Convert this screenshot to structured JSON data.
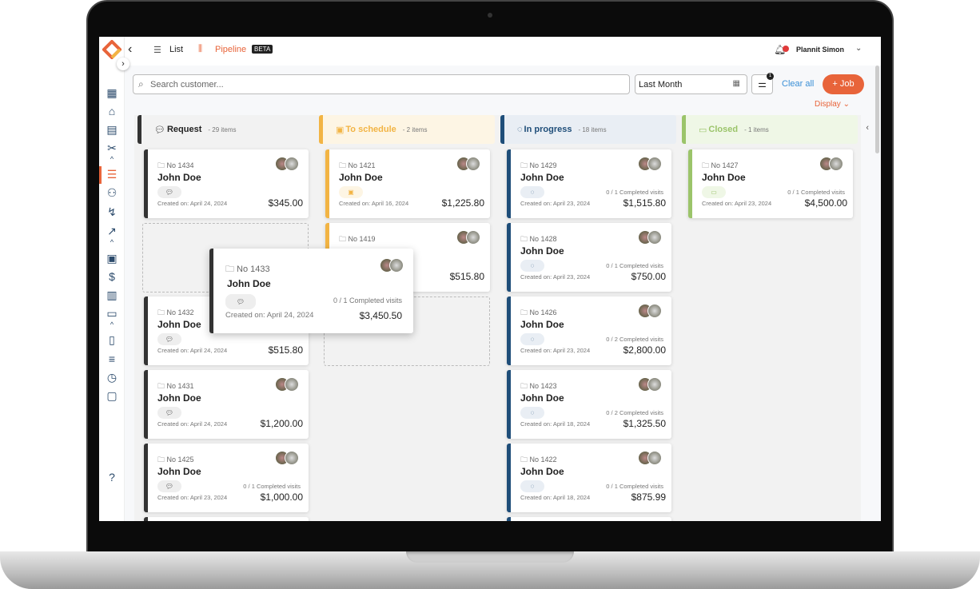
{
  "header": {
    "list_label": "List",
    "pipeline_label": "Pipeline",
    "beta_badge": "BETA",
    "user_name": "Plannit Simon"
  },
  "toolbar": {
    "search_placeholder": "Search customer...",
    "date_filter": "Last Month",
    "filter_count": "1",
    "clear_all": "Clear all",
    "add_job": "Job",
    "display": "Display"
  },
  "colors": {
    "accent": "#e8643a",
    "request": "#333333",
    "schedule": "#f2b444",
    "progress": "#1f4e79",
    "closed": "#9bc46a"
  },
  "columns": [
    {
      "key": "request",
      "title": "Request",
      "count": "- 29 items",
      "icon": "chat-icon",
      "color": "#333333",
      "headbg": "#f2f2f2",
      "textcolor": "#222222",
      "pillbg": "#eeeeee",
      "cards": [
        {
          "no": "No 1434",
          "name": "John Doe",
          "visits": "",
          "created": "Created on: April 24, 2024",
          "amount": "$345.00"
        },
        {
          "placeholder": true
        },
        {
          "no": "No 1432",
          "name": "John Doe",
          "visits": "",
          "created": "Created on: April 24, 2024",
          "amount": "$515.80"
        },
        {
          "no": "No 1431",
          "name": "John Doe",
          "visits": "",
          "created": "Created on: April 24, 2024",
          "amount": "$1,200.00"
        },
        {
          "no": "No 1425",
          "name": "John Doe",
          "visits": "0 / 1 Completed visits",
          "created": "Created on: April 23, 2024",
          "amount": "$1,000.00"
        },
        {
          "partial": true
        }
      ]
    },
    {
      "key": "schedule",
      "title": "To schedule",
      "count": "- 2 items",
      "icon": "calendar-plus-icon",
      "color": "#f2b444",
      "headbg": "#fdf5e4",
      "textcolor": "#f2b444",
      "pillbg": "#fdf5e4",
      "cards": [
        {
          "no": "No 1421",
          "name": "John Doe",
          "visits": "",
          "created": "Created on: April 16, 2024",
          "amount": "$1,225.80"
        },
        {
          "no": "No 1419",
          "name": "",
          "visits": "",
          "created": "",
          "amount": "$515.80"
        },
        {
          "placeholder": true
        }
      ]
    },
    {
      "key": "progress",
      "title": "In progress",
      "count": "- 18 items",
      "icon": "spinner-icon",
      "color": "#1f4e79",
      "headbg": "#e9eef4",
      "textcolor": "#1f4e79",
      "pillbg": "#e9eef4",
      "cards": [
        {
          "no": "No 1429",
          "name": "John Doe",
          "visits": "0 / 1 Completed visits",
          "created": "Created on: April 23, 2024",
          "amount": "$1,515.80"
        },
        {
          "no": "No 1428",
          "name": "John Doe",
          "visits": "0 / 1 Completed visits",
          "created": "Created on: April 23, 2024",
          "amount": "$750.00"
        },
        {
          "no": "No 1426",
          "name": "John Doe",
          "visits": "0 / 2 Completed visits",
          "created": "Created on: April 23, 2024",
          "amount": "$2,800.00"
        },
        {
          "no": "No 1423",
          "name": "John Doe",
          "visits": "0 / 2 Completed visits",
          "created": "Created on: April 18, 2024",
          "amount": "$1,325.50"
        },
        {
          "no": "No 1422",
          "name": "John Doe",
          "visits": "0 / 1 Completed visits",
          "created": "Created on: April 18, 2024",
          "amount": "$875.99"
        },
        {
          "partial": true
        }
      ]
    },
    {
      "key": "closed",
      "title": "Closed",
      "count": "- 1 items",
      "icon": "folder-icon",
      "color": "#9bc46a",
      "headbg": "#eff7e6",
      "textcolor": "#9bc46a",
      "pillbg": "#eff7e6",
      "cards": [
        {
          "no": "No 1427",
          "name": "John Doe",
          "visits": "0 / 1 Completed visits",
          "created": "Created on: April 23, 2024",
          "amount": "$4,500.00"
        }
      ]
    }
  ],
  "dragged_card": {
    "no": "No 1433",
    "name": "John Doe",
    "visits": "0 / 1 Completed visits",
    "created": "Created on: April 24, 2024",
    "amount": "$3,450.50"
  }
}
